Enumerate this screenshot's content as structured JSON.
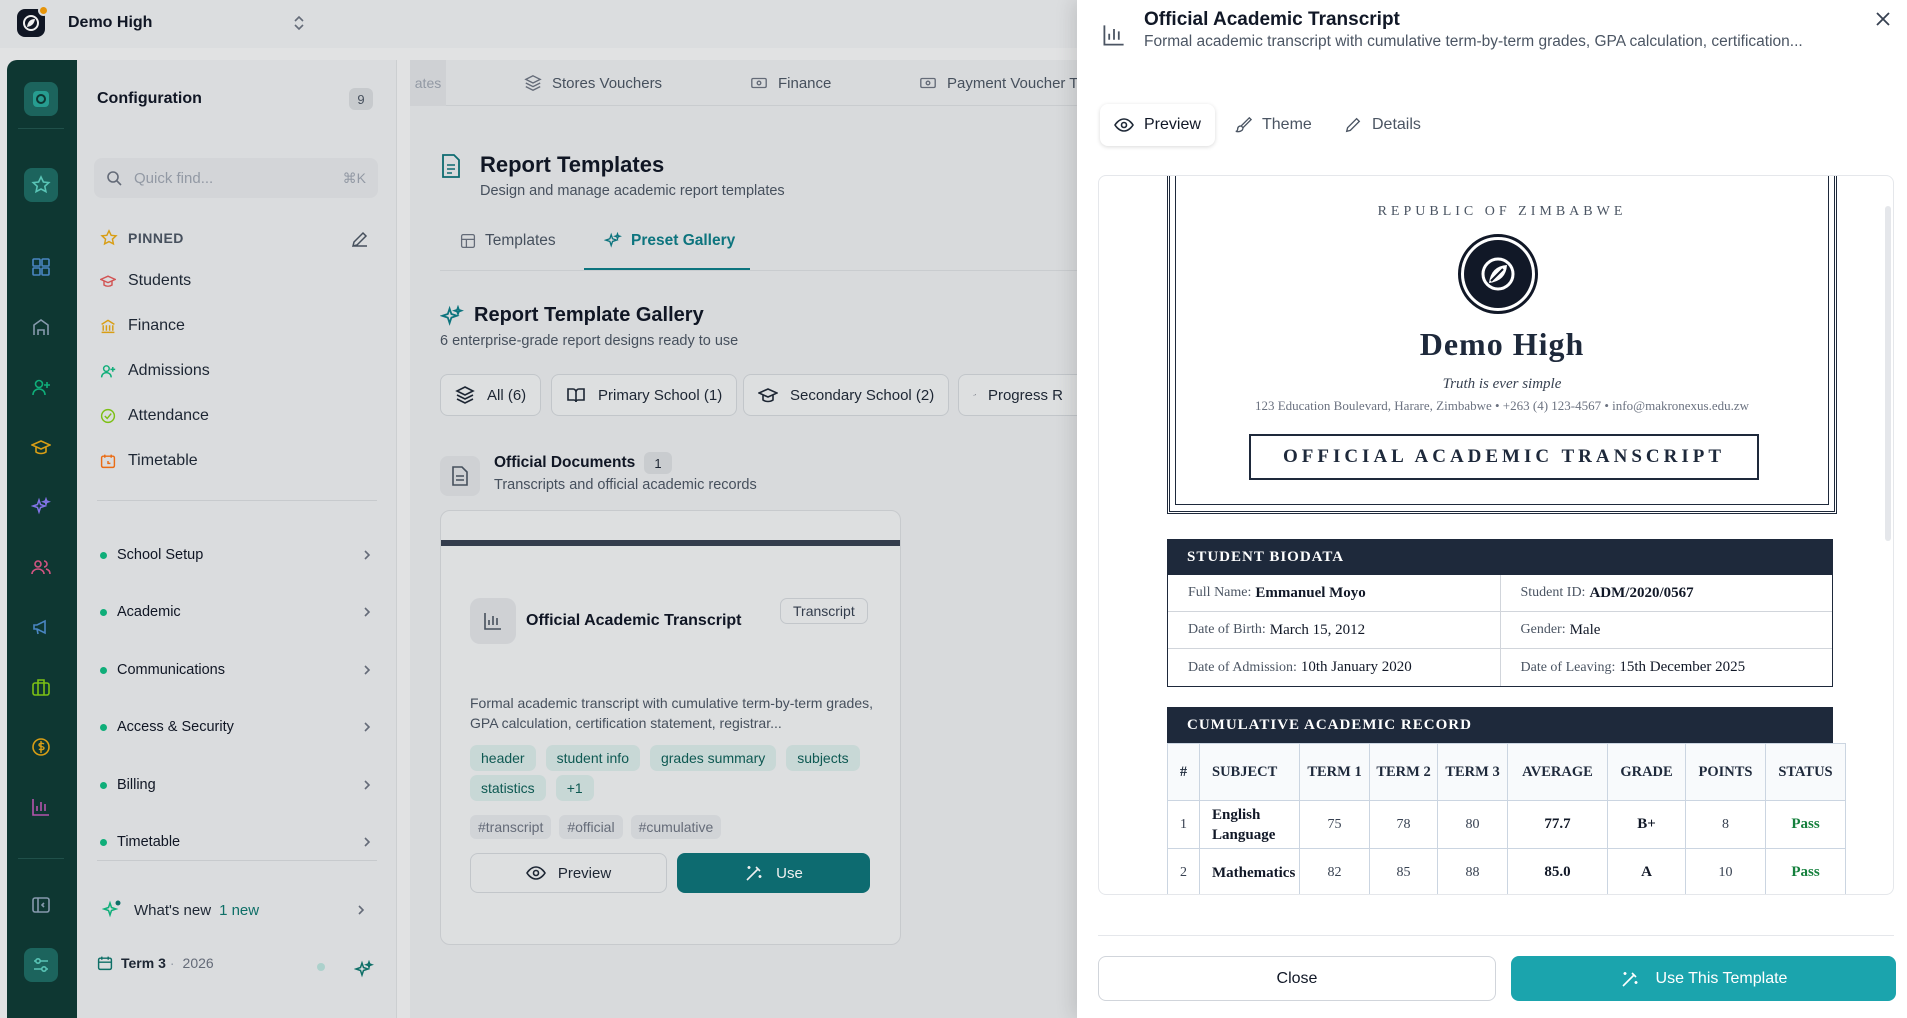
{
  "org": {
    "name": "Demo High"
  },
  "sidebar": {
    "title": "Configuration",
    "count": "9",
    "search_placeholder": "Quick find...",
    "search_shortcut": "⌘K",
    "pinned_label": "PINNED",
    "pinned": [
      {
        "label": "Students",
        "color": "#e05a5a"
      },
      {
        "label": "Finance",
        "color": "#e6a817"
      },
      {
        "label": "Admissions",
        "color": "#10b981"
      },
      {
        "label": "Attendance",
        "color": "#84cc16"
      },
      {
        "label": "Timetable",
        "color": "#f97316"
      }
    ],
    "groups": [
      "School Setup",
      "Academic",
      "Communications",
      "Access & Security",
      "Billing",
      "Timetable"
    ],
    "whats_new_label": "What's new",
    "whats_new_count": "1 new",
    "term": "Term 3",
    "term_sep": "·",
    "year": "2026"
  },
  "main": {
    "tabs": [
      "ates",
      "Stores Vouchers",
      "Finance",
      "Payment Voucher T"
    ],
    "title": "Report Templates",
    "subtitle": "Design and manage academic report templates",
    "subtabs": [
      "Templates",
      "Preset Gallery"
    ],
    "gallery_title": "Report Template Gallery",
    "gallery_subtitle": "6 enterprise-grade report designs ready to use",
    "filters": [
      "All (6)",
      "Primary School (1)",
      "Secondary School (2)",
      "Progress R"
    ],
    "category": {
      "title": "Official Documents",
      "count": "1",
      "subtitle": "Transcripts and official academic records"
    },
    "card": {
      "title": "Official Academic Transcript",
      "badge": "Transcript",
      "description": "Formal academic transcript with cumulative term-by-term grades, GPA calculation, certification statement, registrar...",
      "tags": [
        "header",
        "student info",
        "grades summary",
        "subjects",
        "statistics",
        "+1"
      ],
      "hashtags": [
        "#transcript",
        "#official",
        "#cumulative"
      ],
      "preview_label": "Preview",
      "use_label": "Use"
    }
  },
  "drawer": {
    "title": "Official Academic Transcript",
    "subtitle": "Formal academic transcript with cumulative term-by-term grades, GPA calculation, certification...",
    "tabs": [
      "Preview",
      "Theme",
      "Details"
    ],
    "close_label": "Close",
    "use_label": "Use This Template"
  },
  "transcript": {
    "republic": "REPUBLIC OF ZIMBABWE",
    "school": "Demo High",
    "motto": "Truth is ever simple",
    "address": "123 Education Boulevard, Harare, Zimbabwe • +263 (4) 123-4567 • info@makronexus.edu.zw",
    "doc_title": "OFFICIAL ACADEMIC TRANSCRIPT",
    "bio_header": "STUDENT BIODATA",
    "bio": [
      {
        "label": "Full Name:",
        "value": "Emmanuel Moyo"
      },
      {
        "label": "Student ID:",
        "value": "ADM/2020/0567"
      },
      {
        "label": "Date of Birth:",
        "value": "March 15, 2012"
      },
      {
        "label": "Gender:",
        "value": "Male"
      },
      {
        "label": "Date of Admission:",
        "value": "10th January 2020"
      },
      {
        "label": "Date of Leaving:",
        "value": "15th December 2025"
      }
    ],
    "record_header": "CUMULATIVE ACADEMIC RECORD",
    "columns": [
      "#",
      "SUBJECT",
      "TERM 1",
      "TERM 2",
      "TERM 3",
      "AVERAGE",
      "GRADE",
      "POINTS",
      "STATUS"
    ],
    "rows": [
      [
        "1",
        "English Language",
        "75",
        "78",
        "80",
        "77.7",
        "B+",
        "8",
        "Pass"
      ],
      [
        "2",
        "Mathematics",
        "82",
        "85",
        "88",
        "85.0",
        "A",
        "10",
        "Pass"
      ]
    ]
  },
  "colors": {
    "accent": "#0e7278",
    "primary_button": "#1ba4ad",
    "rail": "#0f3b36",
    "doc_navy": "#1e293b",
    "pass": "#15803d"
  }
}
